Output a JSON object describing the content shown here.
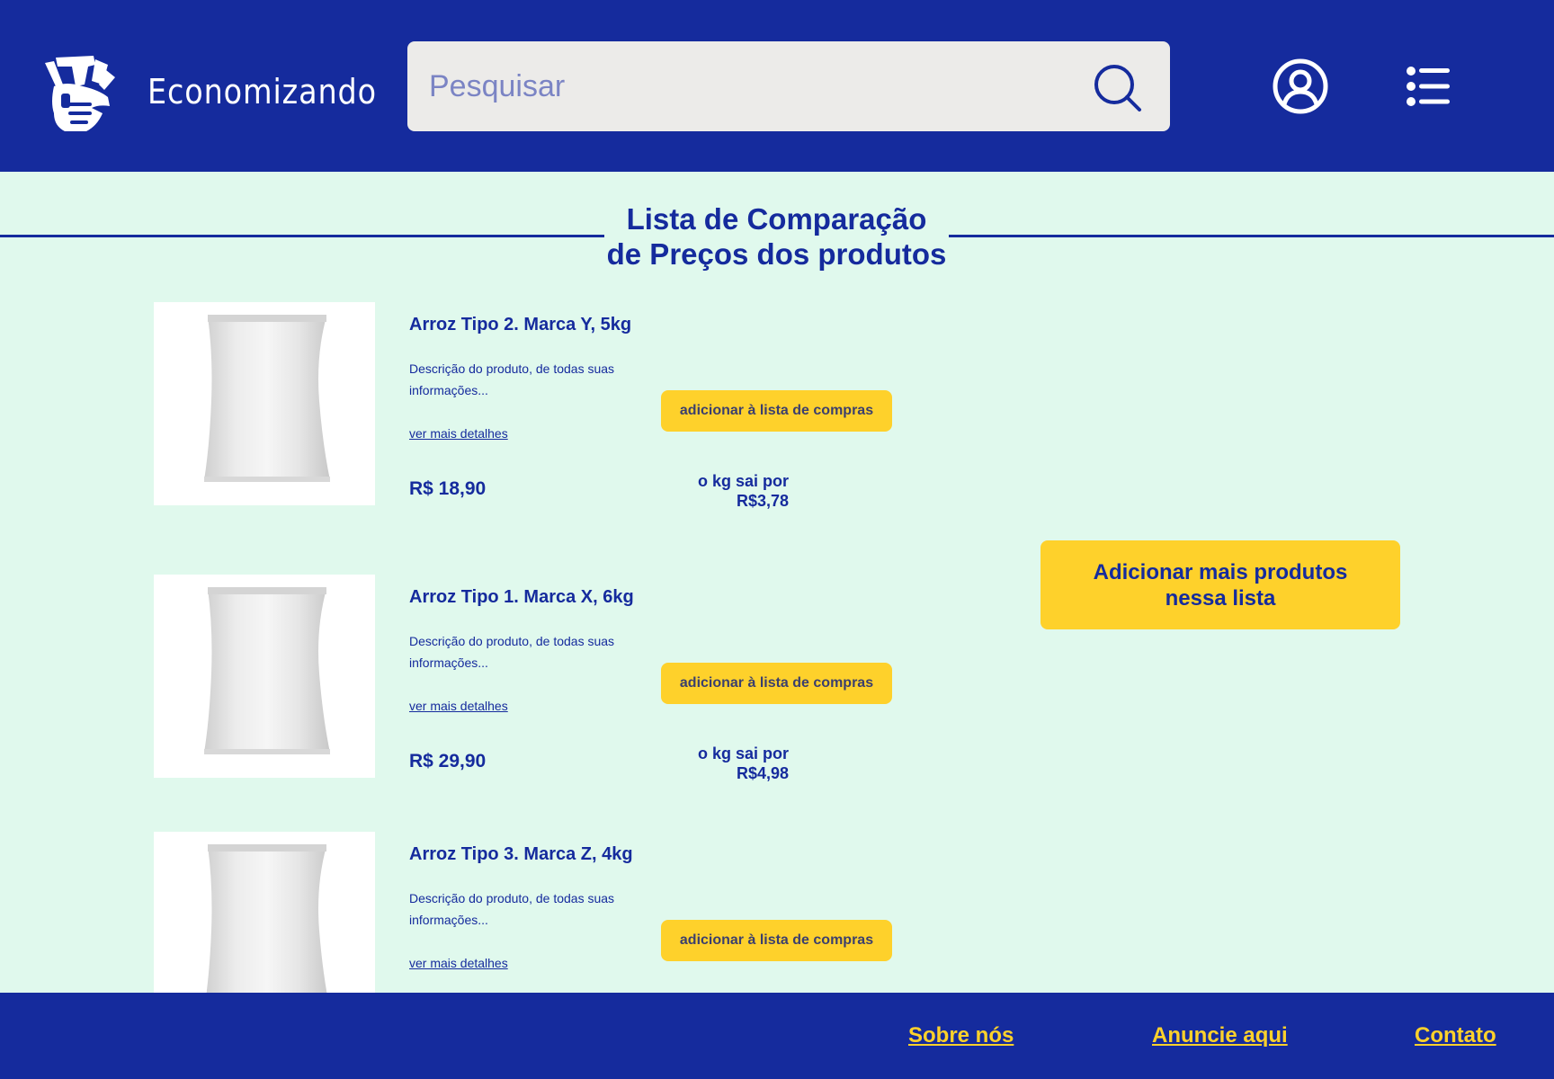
{
  "header": {
    "brand": "Economizando",
    "search_placeholder": "Pesquisar"
  },
  "page": {
    "title_line1": "Lista de Comparação",
    "title_line2": "de Preços dos produtos"
  },
  "products": [
    {
      "name": "Arroz Tipo 2. Marca Y, 5kg",
      "description": "Descrição do produto, de todas suas informações...",
      "details_link": "ver mais detalhes",
      "price": "R$ 18,90",
      "per_kg_label": "o kg sai por",
      "per_kg_value": "R$3,78",
      "add_button": "adicionar à lista de compras"
    },
    {
      "name": "Arroz Tipo 1. Marca X, 6kg",
      "description": "Descrição do produto, de todas suas informações...",
      "details_link": "ver mais detalhes",
      "price": "R$ 29,90",
      "per_kg_label": "o kg sai por",
      "per_kg_value": "R$4,98",
      "add_button": "adicionar à lista de compras"
    },
    {
      "name": "Arroz Tipo 3. Marca Z, 4kg",
      "description": "Descrição do produto, de todas suas informações...",
      "details_link": "ver mais detalhes",
      "add_button": "adicionar à lista de compras"
    }
  ],
  "add_more_button": {
    "line1": "Adicionar mais produtos",
    "line2": "nessa lista"
  },
  "footer": {
    "links": [
      "Sobre nós",
      "Anuncie aqui",
      "Contato"
    ]
  },
  "colors": {
    "primary": "#152b9d",
    "accent": "#fed12b",
    "background": "#e0f9ed",
    "search_bg": "#ecebe9"
  },
  "icons": {
    "logo": "money-hand-logo-icon",
    "search": "search-icon",
    "user": "user-circle-icon",
    "menu": "list-menu-icon"
  }
}
